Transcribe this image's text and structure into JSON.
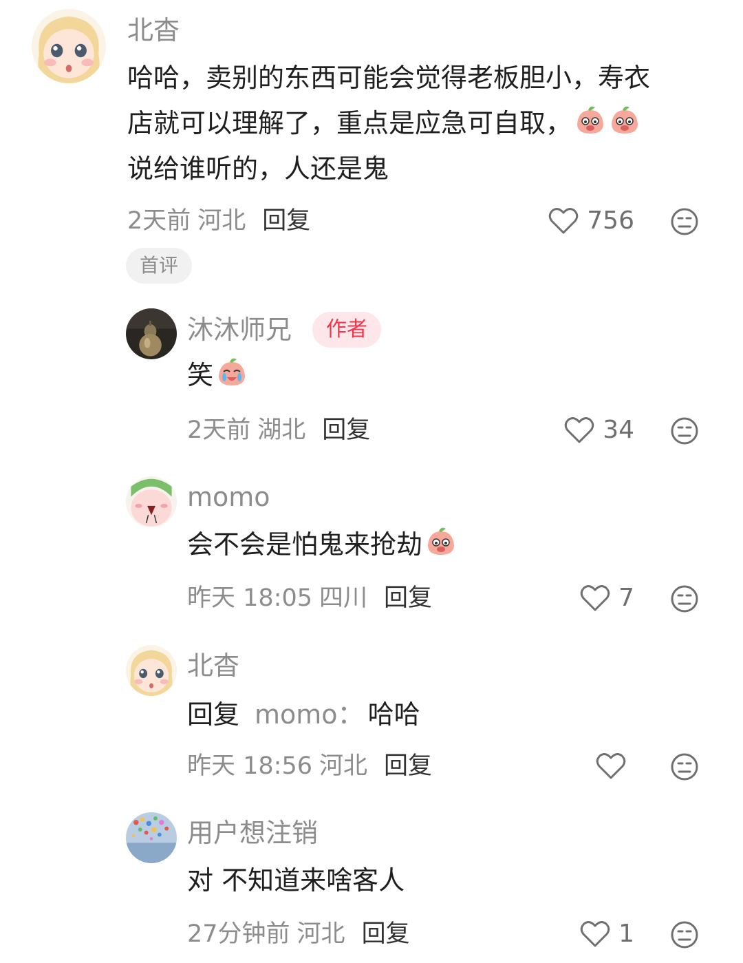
{
  "comments": [
    {
      "name": "北杳",
      "text_lines": [
        "哈哈，卖别的东西可能会觉得老板胆小，寿衣",
        "店就可以理解了，重点是应急可自取，",
        "说给谁听的，人还是鬼"
      ],
      "time": "2天前",
      "location": "河北",
      "reply_label": "回复",
      "likes": "756",
      "tag": "首评"
    },
    {
      "name": "沐沐师兄",
      "badge": "作者",
      "text": "笑",
      "time": "2天前",
      "location": "湖北",
      "reply_label": "回复",
      "likes": "34"
    },
    {
      "name": "momo",
      "text": "会不会是怕鬼来抢劫",
      "time": "昨天 18:05",
      "location": "四川",
      "reply_label": "回复",
      "likes": "7"
    },
    {
      "name": "北杳",
      "reply_prefix": "回复",
      "reply_target": "momo：",
      "text": "哈哈",
      "time": "昨天 18:56",
      "location": "河北",
      "reply_label": "回复",
      "likes": ""
    },
    {
      "name": "用户想注销",
      "text": "对 不知道来啥客人",
      "time": "27分钟前",
      "location": "河北",
      "reply_label": "回复",
      "likes": "1"
    }
  ],
  "colors": {
    "author_badge_bg": "#fde7ea",
    "author_badge_text": "#f0364c",
    "muted_text": "#8c8c8c"
  },
  "icons": [
    "heart-icon",
    "dislike-face-icon",
    "peach-emoji-icon"
  ]
}
